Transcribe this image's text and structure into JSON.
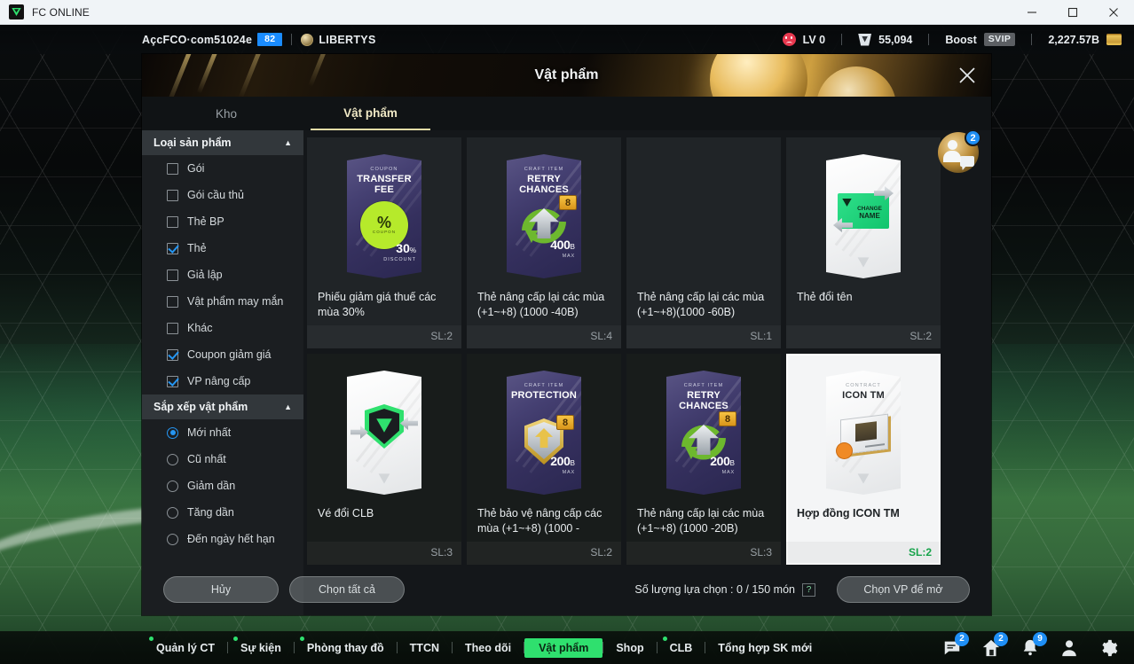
{
  "window": {
    "title": "FC ONLINE",
    "minimize_label": "minimize",
    "maximize_label": "maximize",
    "close_label": "close"
  },
  "account": {
    "name": "AçcFCO·com51024e",
    "level_badge": "82",
    "guild": "LIBERTYS",
    "mood_level": "LV 0",
    "bp": "55,094",
    "boost_label": "Boost",
    "vip": "SVIP",
    "coins": "2,227.57B"
  },
  "modal": {
    "title": "Vật phẩm",
    "close_icon": "close-icon",
    "avatar_badge": "2",
    "tabs": [
      {
        "label": "Kho",
        "active": false
      },
      {
        "label": "Vật phẩm",
        "active": true
      }
    ]
  },
  "sidebar": {
    "sections": [
      {
        "title": "Loại sản phẩm",
        "caret": "▲",
        "type": "checkbox",
        "options": [
          {
            "label": "Gói",
            "checked": false
          },
          {
            "label": "Gói cầu thủ",
            "checked": false
          },
          {
            "label": "Thẻ BP",
            "checked": false
          },
          {
            "label": "Thẻ",
            "checked": true
          },
          {
            "label": "Giả lập",
            "checked": false
          },
          {
            "label": "Vật phẩm may mắn",
            "checked": false
          },
          {
            "label": "Khác",
            "checked": false
          },
          {
            "label": "Coupon giảm giá",
            "checked": true
          },
          {
            "label": "VP nâng cấp",
            "checked": true
          }
        ]
      },
      {
        "title": "Sắp xếp vật phẩm",
        "caret": "▲",
        "type": "radio",
        "options": [
          {
            "label": "Mới nhất",
            "checked": true
          },
          {
            "label": "Cũ nhất",
            "checked": false
          },
          {
            "label": "Giảm dần",
            "checked": false
          },
          {
            "label": "Tăng dần",
            "checked": false
          },
          {
            "label": "Đến ngày hết hạn",
            "checked": false
          }
        ]
      }
    ]
  },
  "items": [
    {
      "name": "Phiếu giảm giá thuế các mùa 30%",
      "qty": "SL:2",
      "art": "coupon",
      "art_sub": "COUPON",
      "art_title": "TRANSFER FEE",
      "badge_value": "%",
      "badge_sub": "COUPON",
      "discount_value": "30",
      "discount_unit": "%",
      "discount_label": "DISCOUNT",
      "selected": false,
      "faded": false
    },
    {
      "name": "Thẻ nâng cấp lại các mùa (+1~+8) (1000 -40B)",
      "qty": "SL:4",
      "art": "retry",
      "art_sub": "CRAFT ITEM",
      "art_title": "RETRY CHANCES",
      "stack": "8",
      "price_value": "400",
      "price_unit": "B",
      "price_label": "MAX",
      "selected": false,
      "faded": false
    },
    {
      "name": "Thẻ nâng cấp lại các mùa (+1~+8)(1000 -60B)",
      "qty": "SL:1",
      "art": "none",
      "selected": false,
      "faded": false
    },
    {
      "name": "Thẻ đổi tên",
      "qty": "SL:2",
      "art": "changename",
      "art_label_1": "CHANGE",
      "art_label_2": "NAME",
      "selected": false,
      "faded": false
    },
    {
      "name": "Vé đổi CLB",
      "qty": "SL:3",
      "art": "club",
      "selected": false,
      "faded": true
    },
    {
      "name": "Thẻ bảo vệ nâng cấp các mùa (+1~+8) (1000 -",
      "qty": "SL:2",
      "art": "protection",
      "art_sub": "CRAFT ITEM",
      "art_title": "PROTECTION",
      "stack": "8",
      "price_value": "200",
      "price_unit": "B",
      "price_label": "MAX",
      "selected": false,
      "faded": true
    },
    {
      "name": "Thẻ nâng cấp lại các mùa (+1~+8) (1000 -20B)",
      "qty": "SL:3",
      "art": "retry",
      "art_sub": "CRAFT ITEM",
      "art_title": "RETRY CHANCES",
      "stack": "8",
      "price_value": "200",
      "price_unit": "B",
      "price_label": "MAX",
      "selected": false,
      "faded": true
    },
    {
      "name": "Hợp đồng ICON TM",
      "qty": "SL:2",
      "art": "icontm",
      "art_sub": "CONTRACT",
      "art_title": "ICON TM",
      "selected": true,
      "faded": false
    }
  ],
  "actions": {
    "cancel": "Hủy",
    "select_all": "Chọn tất cả",
    "count_text": "Số lượng lựa chọn : 0 / 150 món",
    "help": "?",
    "open_vp": "Chọn VP để mở"
  },
  "bottom_nav": {
    "items": [
      {
        "label": "Quản lý CT",
        "dot": true,
        "active": false
      },
      {
        "label": "Sự kiện",
        "dot": true,
        "active": false
      },
      {
        "label": "Phòng thay đồ",
        "dot": true,
        "active": false
      },
      {
        "label": "TTCN",
        "dot": false,
        "active": false
      },
      {
        "label": "Theo dõi",
        "dot": false,
        "active": false
      },
      {
        "label": "Vật phẩm",
        "dot": false,
        "active": true
      },
      {
        "label": "Shop",
        "dot": false,
        "active": false
      },
      {
        "label": "CLB",
        "dot": true,
        "active": false
      },
      {
        "label": "Tổng hợp SK mới",
        "dot": false,
        "active": false
      }
    ],
    "icons": [
      {
        "name": "chat-icon",
        "badge": "2"
      },
      {
        "name": "home-icon",
        "badge": "2"
      },
      {
        "name": "bell-icon",
        "badge": "9"
      },
      {
        "name": "profile-icon",
        "badge": ""
      },
      {
        "name": "gear-icon",
        "badge": ""
      }
    ]
  },
  "colors": {
    "accent_green": "#2fe06e",
    "accent_blue": "#1f8ff5",
    "tab_gold": "#e3dca6"
  }
}
